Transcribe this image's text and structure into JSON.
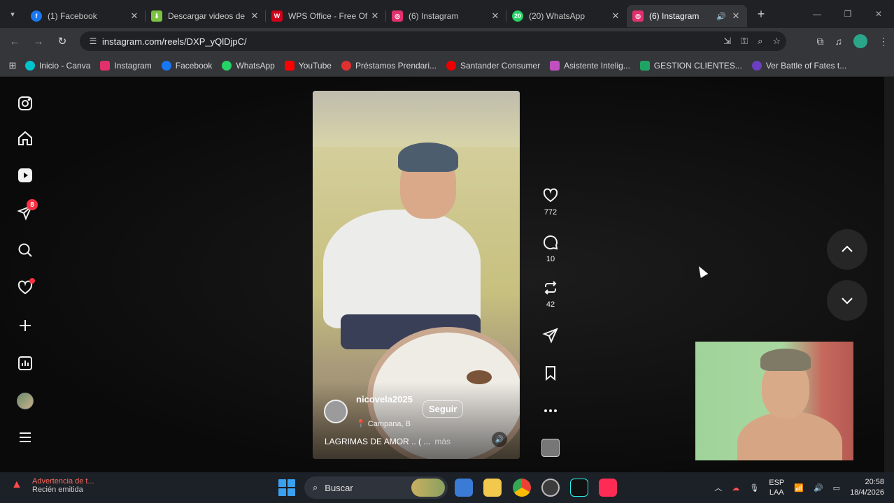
{
  "browser": {
    "tabs": [
      {
        "title": "(1) Facebook",
        "favicon": "facebook-icon",
        "color": "#1877f2"
      },
      {
        "title": "Descargar videos de",
        "favicon": "download-icon",
        "color": "#7cc242"
      },
      {
        "title": "WPS Office - Free Of",
        "favicon": "wps-icon",
        "color": "#d0021b"
      },
      {
        "title": "(6) Instagram",
        "favicon": "instagram-icon",
        "color": "#e1306c"
      },
      {
        "title": "(20) WhatsApp",
        "favicon": "whatsapp-icon",
        "color": "#25d366"
      },
      {
        "title": "(6) Instagram",
        "favicon": "instagram-icon",
        "color": "#e1306c",
        "active": true,
        "audio": true
      }
    ],
    "url": "instagram.com/reels/DXP_yQlDjpC/",
    "bookmarks": [
      {
        "label": "Inicio - Canva",
        "color": "#00c4cc"
      },
      {
        "label": "Instagram",
        "color": "#e1306c"
      },
      {
        "label": "Facebook",
        "color": "#1877f2"
      },
      {
        "label": "WhatsApp",
        "color": "#25d366"
      },
      {
        "label": "YouTube",
        "color": "#ff0000"
      },
      {
        "label": "Préstamos Prendari...",
        "color": "#e03030"
      },
      {
        "label": "Santander Consumer",
        "color": "#ec0000"
      },
      {
        "label": "Asistente Intelig...",
        "color": "#c050c0"
      },
      {
        "label": "GESTION CLIENTES...",
        "color": "#1fa463"
      },
      {
        "label": "Ver Battle of Fates t...",
        "color": "#6a3fc0"
      }
    ]
  },
  "sidebar": {
    "notifications_badge": "8"
  },
  "reel": {
    "username": "nicovela2025",
    "follow_label": "Seguir",
    "location": "Campana, B",
    "caption": "LAGRIMAS DE AMOR .. ( ...",
    "more_label": "más"
  },
  "actions": {
    "likes": "772",
    "comments": "10",
    "reposts": "42"
  },
  "taskbar": {
    "notification_title": "Advertencia de t...",
    "notification_sub": "Recién emitida",
    "search_placeholder": "Buscar",
    "lang_top": "ESP",
    "lang_bottom": "LAA",
    "time": "20:58",
    "date": "18/4/2026"
  }
}
